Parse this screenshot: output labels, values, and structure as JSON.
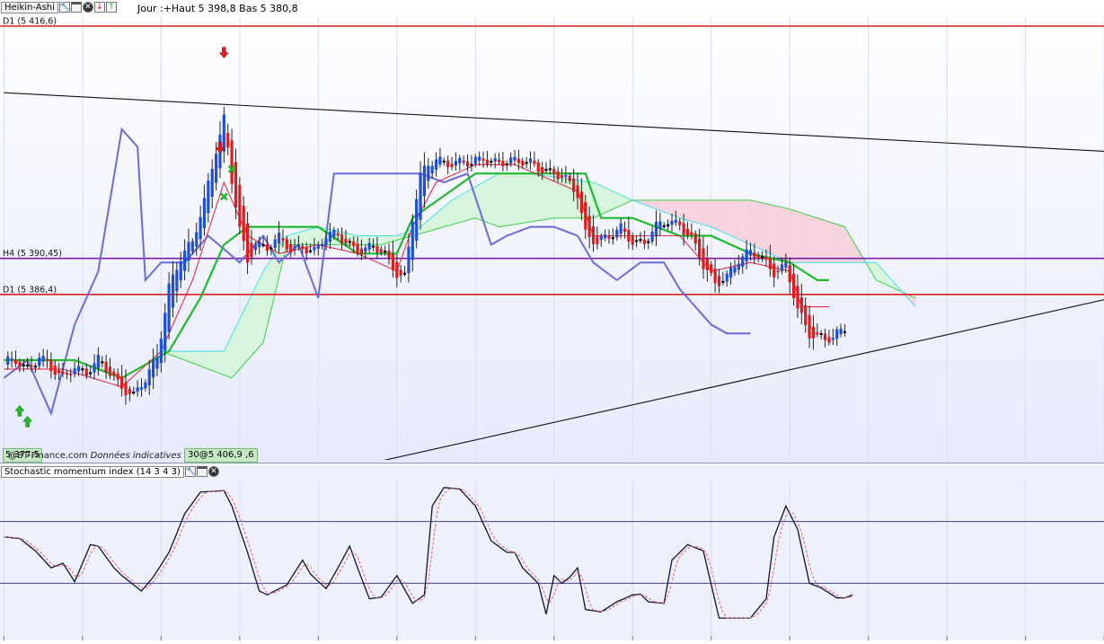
{
  "main_panel": {
    "title": "Heikin-Ashi",
    "info": "Jour :+Haut 5 398,8 Bas 5 380,8",
    "watermark_source": "@BT-Finance.com",
    "watermark_note": "Données indicatives",
    "price_tag_left": "5 377,5",
    "price_tag_center": "30@5 406,9 ,6"
  },
  "sub_panel": {
    "title": "Stochastic momentum index (14 3 4 3)"
  },
  "icons": {
    "settings": "wrench-icon",
    "window": "window-icon",
    "close": "close-icon",
    "down": "arrow-down-icon",
    "up": "arrow-up-icon"
  },
  "colors": {
    "bull": "#1f4fd6",
    "bear": "#e01b1b",
    "ha_neutral": "#000000",
    "tenkan": "#e0304a",
    "kijun": "#1fba2c",
    "chikou": "#6a6adc",
    "span_a": "#40e0e8",
    "span_b": "#3ccf44",
    "kumo_bull": "#d6f5dc",
    "kumo_bear": "#f7d3dd",
    "level_red": "#e02020",
    "level_purple": "#7a1fa6",
    "smi": "#111133",
    "smi_signal": "#e07070",
    "panel_bg": "#eef0fb"
  },
  "chart_data": [
    {
      "type": "heikin-ashi-candlestick",
      "panel": "main",
      "title": "Heikin-Ashi",
      "x_unit": "bar index",
      "xlim": [
        0,
        280
      ],
      "ylim": [
        5363,
        5420
      ],
      "grid": true,
      "levels": [
        {
          "label": "D1 (5 416,6)",
          "value": 5416.6,
          "color": "#e02020"
        },
        {
          "label": "H4 (5 390,45)",
          "value": 5390.45,
          "color": "#7a1fa6"
        },
        {
          "label": "D1 (5 386,4)",
          "value": 5386.4,
          "color": "#e02020"
        }
      ],
      "trendlines": [
        {
          "points": [
            [
              0,
              5409.1
            ],
            [
              280,
              5402.5
            ]
          ]
        },
        {
          "points": [
            [
              66,
              5364.7
            ],
            [
              280,
              5385.8
            ]
          ]
        }
      ],
      "close": [
        [
          0,
          5378.5
        ],
        [
          3,
          5379.0
        ],
        [
          6,
          5378.2
        ],
        [
          9,
          5379.4
        ],
        [
          12,
          5377.8
        ],
        [
          15,
          5377.0
        ],
        [
          18,
          5378.6
        ],
        [
          21,
          5377.4
        ],
        [
          24,
          5378.8
        ],
        [
          27,
          5377.6
        ],
        [
          30,
          5376.2
        ],
        [
          33,
          5374.9
        ],
        [
          36,
          5376.6
        ],
        [
          39,
          5379.4
        ],
        [
          42,
          5387.5
        ],
        [
          45,
          5390.5
        ],
        [
          48,
          5392.0
        ],
        [
          51,
          5397.0
        ],
        [
          54,
          5403.0
        ],
        [
          56,
          5406.2
        ],
        [
          58,
          5399.0
        ],
        [
          60,
          5393.5
        ],
        [
          62,
          5390.0
        ],
        [
          64,
          5392.4
        ],
        [
          67,
          5391.8
        ],
        [
          70,
          5392.6
        ],
        [
          73,
          5391.2
        ],
        [
          76,
          5392.0
        ],
        [
          79,
          5391.4
        ],
        [
          82,
          5392.8
        ],
        [
          85,
          5393.0
        ],
        [
          88,
          5392.1
        ],
        [
          91,
          5391.4
        ],
        [
          94,
          5391.6
        ],
        [
          97,
          5390.8
        ],
        [
          100,
          5389.0
        ],
        [
          102,
          5388.5
        ],
        [
          104,
          5395.0
        ],
        [
          106,
          5399.5
        ],
        [
          108,
          5400.8
        ],
        [
          110,
          5401.7
        ],
        [
          113,
          5401.4
        ],
        [
          116,
          5401.2
        ],
        [
          119,
          5400.9
        ],
        [
          122,
          5401.8
        ],
        [
          125,
          5401.5
        ],
        [
          128,
          5401.3
        ],
        [
          131,
          5401.1
        ],
        [
          134,
          5401.3
        ],
        [
          137,
          5400.7
        ],
        [
          140,
          5399.9
        ],
        [
          143,
          5399.1
        ],
        [
          146,
          5397.8
        ],
        [
          148,
          5393.5
        ],
        [
          151,
          5392.3
        ],
        [
          154,
          5392.6
        ],
        [
          157,
          5393.9
        ],
        [
          160,
          5392.6
        ],
        [
          163,
          5392.2
        ],
        [
          166,
          5393.8
        ],
        [
          169,
          5394.7
        ],
        [
          172,
          5394.5
        ],
        [
          175,
          5392.7
        ],
        [
          178,
          5389.4
        ],
        [
          181,
          5387.6
        ],
        [
          184,
          5388.7
        ],
        [
          187,
          5390.3
        ],
        [
          190,
          5390.9
        ],
        [
          193,
          5390.5
        ],
        [
          196,
          5389.1
        ],
        [
          199,
          5389.6
        ],
        [
          202,
          5384.4
        ],
        [
          205,
          5382.0
        ],
        [
          208,
          5381.8
        ],
        [
          211,
          5381.4
        ],
        [
          214,
          5382.4
        ]
      ],
      "kijun": [
        [
          0,
          5379
        ],
        [
          18,
          5379
        ],
        [
          30,
          5377
        ],
        [
          42,
          5380
        ],
        [
          50,
          5386
        ],
        [
          56,
          5392
        ],
        [
          62,
          5394
        ],
        [
          70,
          5394
        ],
        [
          80,
          5394
        ],
        [
          90,
          5391
        ],
        [
          100,
          5391
        ],
        [
          104,
          5395
        ],
        [
          120,
          5400
        ],
        [
          126,
          5400
        ],
        [
          130,
          5400
        ],
        [
          148,
          5400
        ],
        [
          152,
          5395
        ],
        [
          160,
          5395
        ],
        [
          172,
          5393
        ],
        [
          180,
          5393
        ],
        [
          190,
          5391
        ],
        [
          200,
          5390
        ],
        [
          207,
          5388
        ],
        [
          210,
          5388
        ]
      ],
      "tenkan": [
        [
          0,
          5378
        ],
        [
          15,
          5378
        ],
        [
          30,
          5376
        ],
        [
          40,
          5380
        ],
        [
          48,
          5388
        ],
        [
          56,
          5399
        ],
        [
          62,
          5393
        ],
        [
          70,
          5391
        ],
        [
          80,
          5392
        ],
        [
          90,
          5391
        ],
        [
          100,
          5389
        ],
        [
          104,
          5394
        ],
        [
          110,
          5399
        ],
        [
          120,
          5401
        ],
        [
          130,
          5401
        ],
        [
          146,
          5398
        ],
        [
          150,
          5393
        ],
        [
          160,
          5393
        ],
        [
          172,
          5393
        ],
        [
          180,
          5389
        ],
        [
          190,
          5390
        ],
        [
          200,
          5389
        ],
        [
          203,
          5385
        ],
        [
          210,
          5385
        ]
      ],
      "chikou": [
        [
          0,
          5377
        ],
        [
          6,
          5379
        ],
        [
          12,
          5373
        ],
        [
          18,
          5383
        ],
        [
          24,
          5389
        ],
        [
          30,
          5405
        ],
        [
          34,
          5403
        ],
        [
          36,
          5388
        ],
        [
          40,
          5390
        ],
        [
          46,
          5390
        ],
        [
          52,
          5393
        ],
        [
          60,
          5390
        ],
        [
          66,
          5393
        ],
        [
          70,
          5390
        ],
        [
          75,
          5392
        ],
        [
          80,
          5386
        ],
        [
          84,
          5400
        ],
        [
          90,
          5400
        ],
        [
          100,
          5400
        ],
        [
          106,
          5400
        ],
        [
          112,
          5399
        ],
        [
          118,
          5400
        ],
        [
          124,
          5392
        ],
        [
          128,
          5393
        ],
        [
          134,
          5394
        ],
        [
          140,
          5394
        ],
        [
          146,
          5393
        ],
        [
          150,
          5390
        ],
        [
          156,
          5388
        ],
        [
          162,
          5390
        ],
        [
          168,
          5390
        ],
        [
          172,
          5387
        ],
        [
          176,
          5385
        ],
        [
          180,
          5383
        ],
        [
          184,
          5382
        ],
        [
          190,
          5382
        ]
      ],
      "span_a": [
        [
          40,
          5380
        ],
        [
          56,
          5380
        ],
        [
          66,
          5389
        ],
        [
          72,
          5393
        ],
        [
          80,
          5394
        ],
        [
          90,
          5393
        ],
        [
          100,
          5393
        ],
        [
          106,
          5394
        ],
        [
          114,
          5397
        ],
        [
          126,
          5400
        ],
        [
          134,
          5400
        ],
        [
          150,
          5399
        ],
        [
          160,
          5397
        ],
        [
          172,
          5395
        ],
        [
          180,
          5394
        ],
        [
          190,
          5392
        ],
        [
          200,
          5390
        ],
        [
          212,
          5390
        ],
        [
          222,
          5390
        ],
        [
          232,
          5385
        ]
      ],
      "span_b": [
        [
          40,
          5380
        ],
        [
          58,
          5377
        ],
        [
          66,
          5381
        ],
        [
          72,
          5392
        ],
        [
          80,
          5392
        ],
        [
          96,
          5392
        ],
        [
          104,
          5393
        ],
        [
          120,
          5395
        ],
        [
          126,
          5394
        ],
        [
          140,
          5395
        ],
        [
          150,
          5395
        ],
        [
          160,
          5397
        ],
        [
          170,
          5397
        ],
        [
          178,
          5397
        ],
        [
          190,
          5397
        ],
        [
          200,
          5396
        ],
        [
          214,
          5394
        ],
        [
          222,
          5388
        ],
        [
          232,
          5386
        ]
      ],
      "markers": [
        {
          "x": 56,
          "y": 5413.5,
          "type": "arrow-down",
          "color": "#e02020"
        },
        {
          "x": 55,
          "y": 5402.8,
          "type": "arrow-down",
          "color": "#e02020"
        },
        {
          "x": 6,
          "y": 5372.2,
          "type": "arrow-up",
          "color": "#1fba2c"
        },
        {
          "x": 4,
          "y": 5373.4,
          "type": "arrow-up",
          "color": "#1fba2c"
        },
        {
          "x": 58,
          "y": 5400.5,
          "type": "cross",
          "color": "#1fba2c"
        },
        {
          "x": 56,
          "y": 5397.4,
          "type": "cross",
          "color": "#1fba2c"
        }
      ]
    },
    {
      "type": "line",
      "panel": "oscillator",
      "title": "Stochastic momentum index (14 3 4 3)",
      "x_unit": "bar index",
      "xlim": [
        0,
        280
      ],
      "ylim": [
        -90,
        90
      ],
      "grid": true,
      "levels": [
        40,
        -40
      ],
      "series": [
        {
          "values": [
            [
              0,
              20
            ],
            [
              4,
              18
            ],
            [
              8,
              2
            ],
            [
              12,
              -20
            ],
            [
              15,
              -14
            ],
            [
              18,
              -38
            ],
            [
              22,
              10
            ],
            [
              24,
              8
            ],
            [
              28,
              -20
            ],
            [
              30,
              -30
            ],
            [
              35,
              -50
            ],
            [
              38,
              -32
            ],
            [
              42,
              0
            ],
            [
              46,
              50
            ],
            [
              50,
              78
            ],
            [
              56,
              80
            ],
            [
              58,
              60
            ],
            [
              62,
              0
            ],
            [
              65,
              -50
            ],
            [
              67,
              -55
            ],
            [
              72,
              -42
            ],
            [
              76,
              -10
            ],
            [
              78,
              -28
            ],
            [
              82,
              -47
            ],
            [
              85,
              -20
            ],
            [
              88,
              8
            ],
            [
              90,
              -20
            ],
            [
              93,
              -60
            ],
            [
              96,
              -58
            ],
            [
              100,
              -30
            ],
            [
              104,
              -66
            ],
            [
              107,
              -55
            ],
            [
              109,
              60
            ],
            [
              112,
              84
            ],
            [
              116,
              82
            ],
            [
              120,
              60
            ],
            [
              124,
              15
            ],
            [
              128,
              0
            ],
            [
              130,
              0
            ],
            [
              132,
              -20
            ],
            [
              136,
              -40
            ],
            [
              138,
              -80
            ],
            [
              140,
              -30
            ],
            [
              142,
              -40
            ],
            [
              144,
              -32
            ],
            [
              146,
              -20
            ],
            [
              148,
              -74
            ],
            [
              152,
              -77
            ],
            [
              156,
              -64
            ],
            [
              160,
              -55
            ],
            [
              162,
              -54
            ],
            [
              164,
              -64
            ],
            [
              168,
              -66
            ],
            [
              170,
              -10
            ],
            [
              174,
              10
            ],
            [
              178,
              2
            ],
            [
              182,
              -85
            ],
            [
              186,
              -85
            ],
            [
              190,
              -85
            ],
            [
              194,
              -60
            ],
            [
              196,
              20
            ],
            [
              199,
              60
            ],
            [
              202,
              30
            ],
            [
              205,
              -40
            ],
            [
              208,
              -46
            ],
            [
              212,
              -59
            ],
            [
              214,
              -59
            ],
            [
              216,
              -55
            ]
          ]
        }
      ]
    }
  ]
}
